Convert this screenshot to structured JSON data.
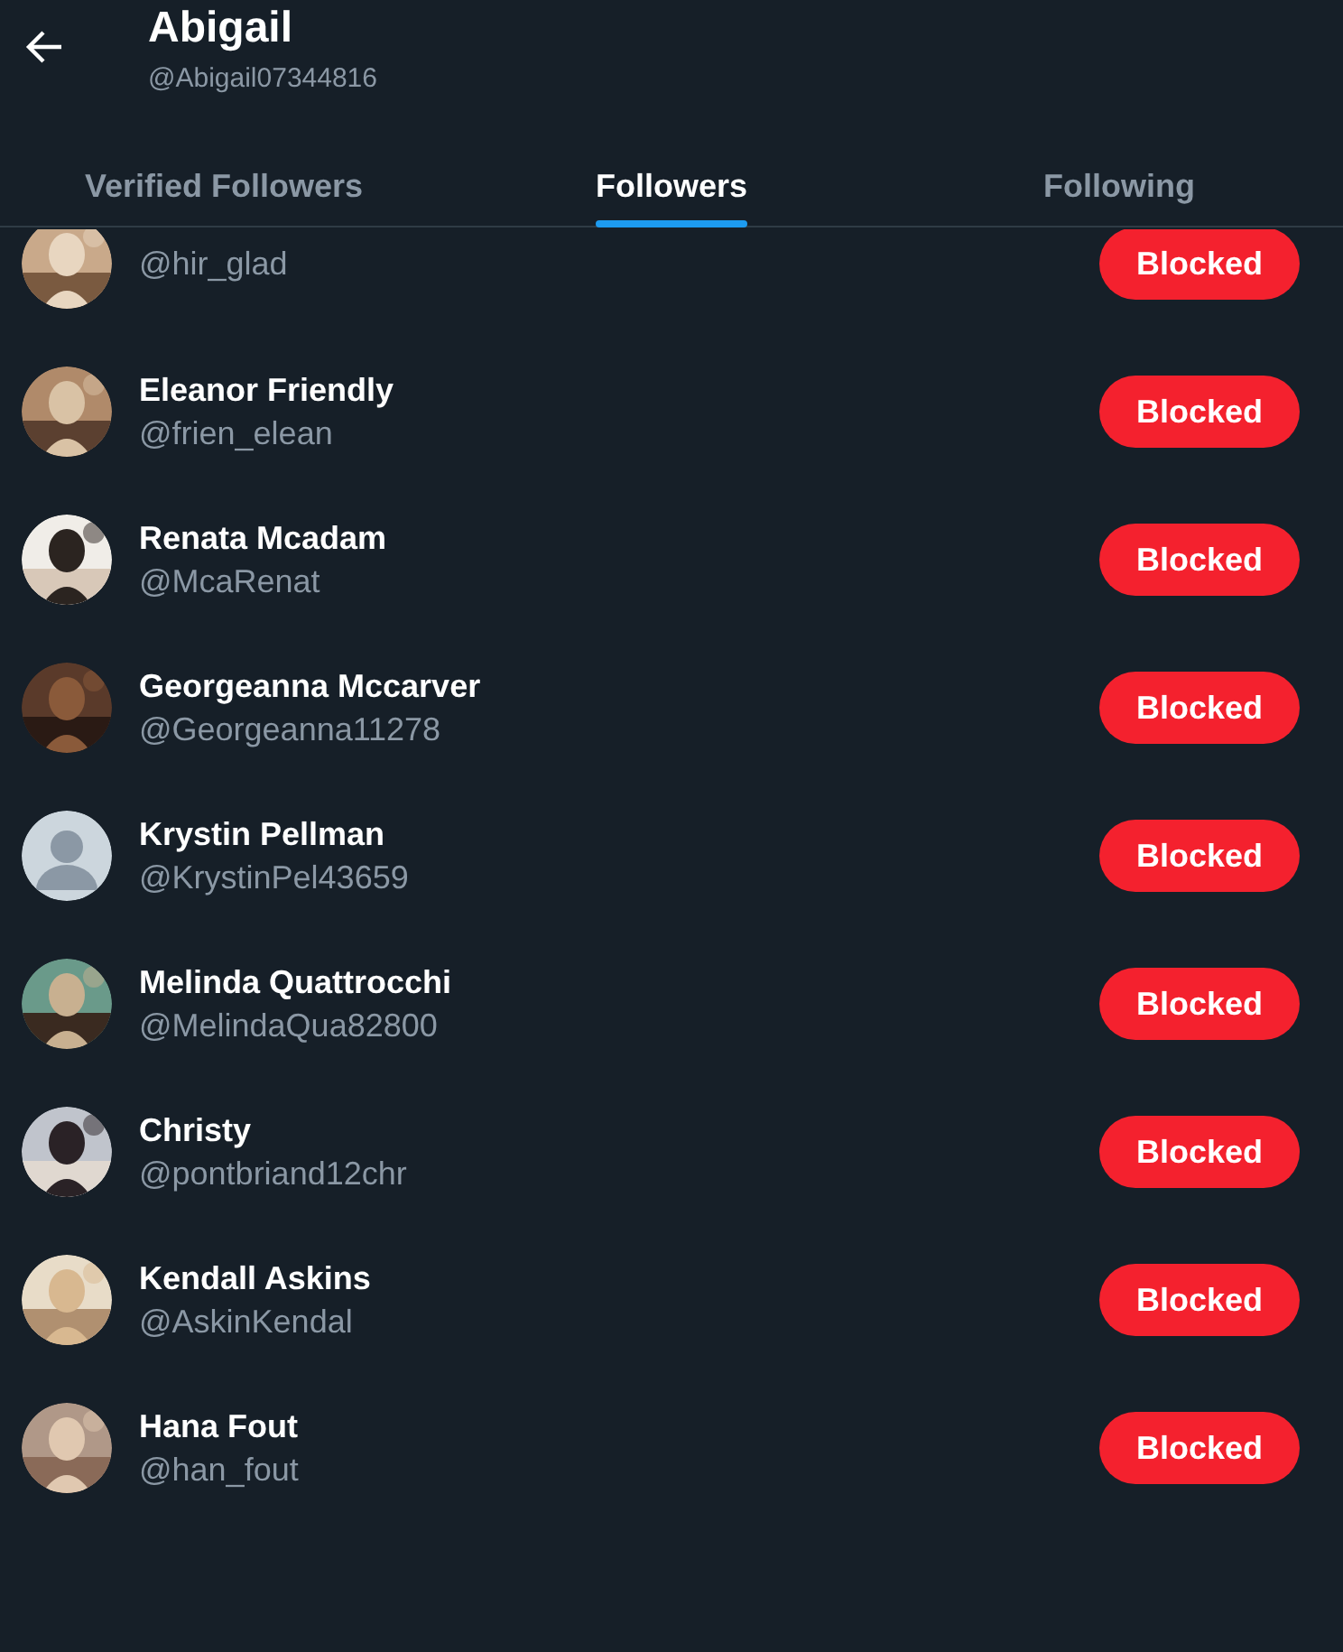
{
  "header": {
    "title": "Abigail",
    "handle": "@Abigail07344816"
  },
  "tabs": [
    {
      "label": "Verified Followers",
      "selected": false
    },
    {
      "label": "Followers",
      "selected": true
    },
    {
      "label": "Following",
      "selected": false
    }
  ],
  "users": [
    {
      "handle": "@hir_glad",
      "button": "Blocked",
      "kind": "picture"
    },
    {
      "name": "Eleanor Friendly",
      "handle": "@frien_elean",
      "button": "Blocked",
      "kind": "picture"
    },
    {
      "name": "Renata Mcadam",
      "handle": "@McaRenat",
      "button": "Blocked",
      "kind": "picture"
    },
    {
      "name": "Georgeanna Mccarver",
      "handle": "@Georgeanna11278",
      "button": "Blocked",
      "kind": "picture"
    },
    {
      "name": "Krystin Pellman",
      "handle": "@KrystinPel43659",
      "button": "Blocked",
      "kind": "placeholder"
    },
    {
      "name": "Melinda Quattrocchi",
      "handle": "@MelindaQua82800",
      "button": "Blocked",
      "kind": "picture"
    },
    {
      "name": "Christy",
      "handle": "@pontbriand12chr",
      "button": "Blocked",
      "kind": "picture"
    },
    {
      "name": "Kendall Askins",
      "handle": "@AskinKendal",
      "button": "Blocked",
      "kind": "picture"
    },
    {
      "name": "Hana Fout",
      "handle": "@han_fout",
      "button": "Blocked",
      "kind": "picture"
    }
  ]
}
